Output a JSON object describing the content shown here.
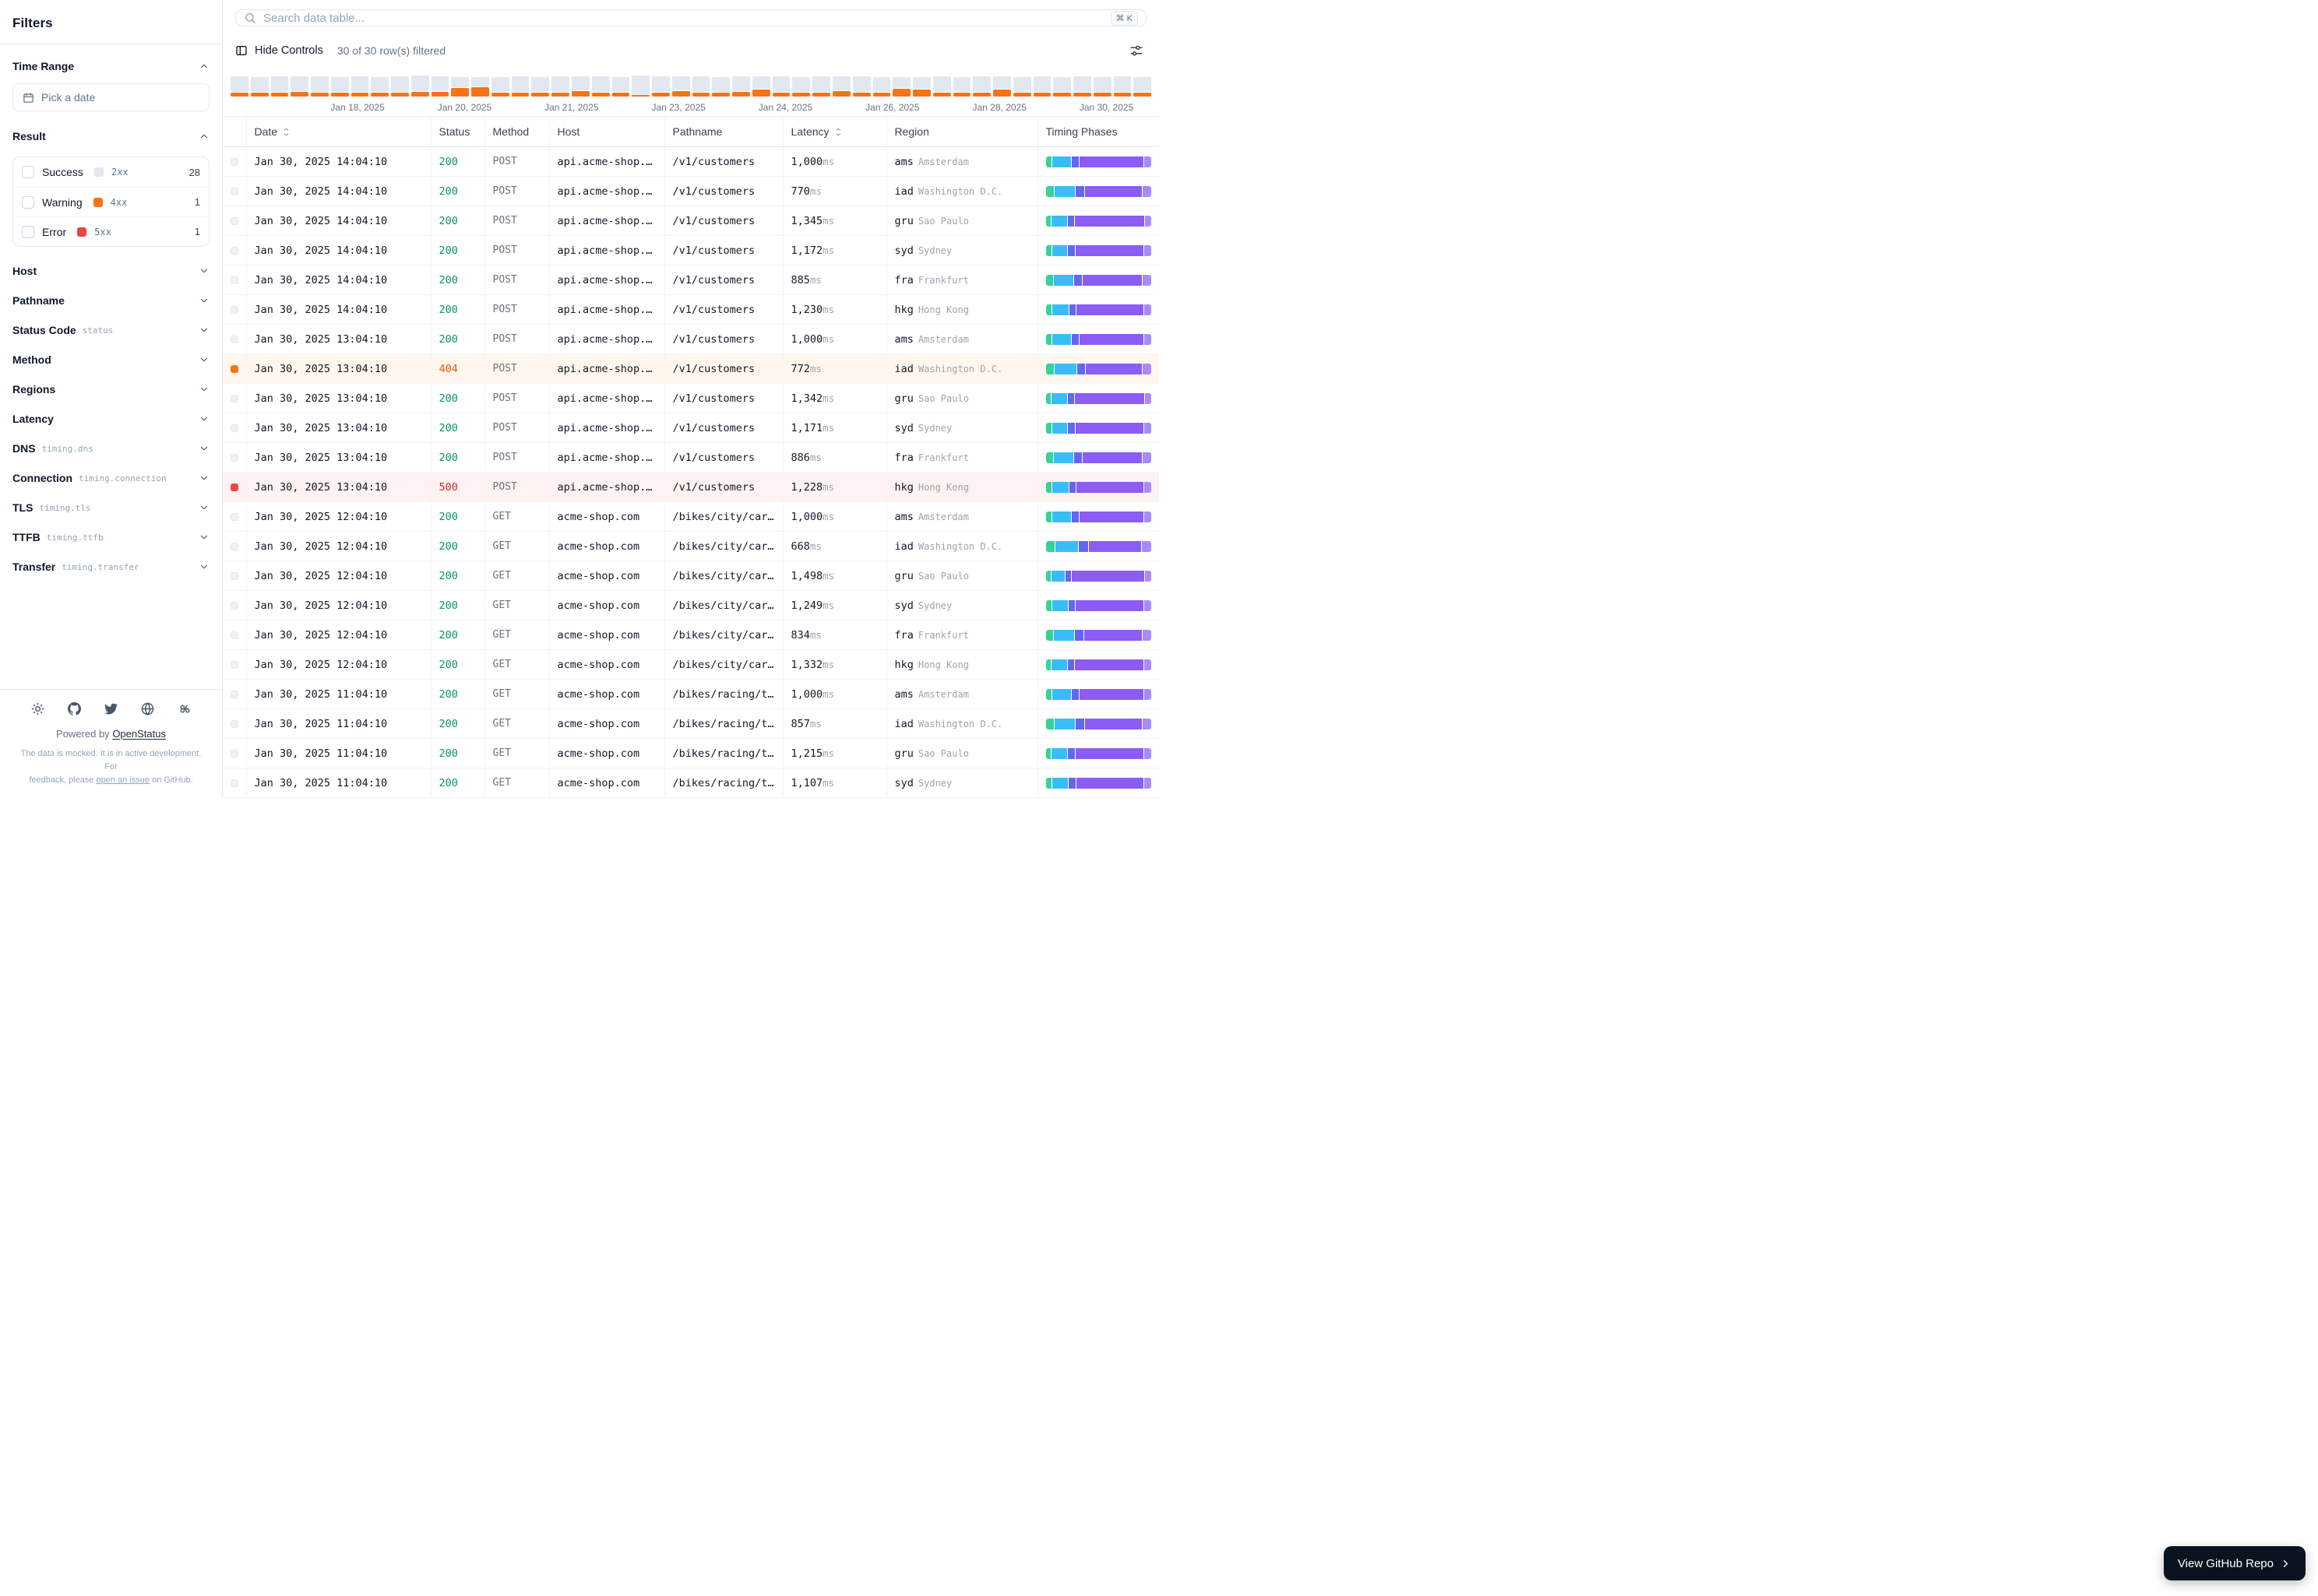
{
  "sidebar": {
    "title": "Filters",
    "time_range": {
      "label": "Time Range",
      "picker_placeholder": "Pick a date"
    },
    "result": {
      "label": "Result",
      "options": [
        {
          "label": "Success",
          "code": "2xx",
          "count": "28",
          "color": "#e2e8f0"
        },
        {
          "label": "Warning",
          "code": "4xx",
          "count": "1",
          "color": "#f97316"
        },
        {
          "label": "Error",
          "code": "5xx",
          "count": "1",
          "color": "#ef4444"
        }
      ]
    },
    "sections": [
      {
        "label": "Host",
        "tag": ""
      },
      {
        "label": "Pathname",
        "tag": ""
      },
      {
        "label": "Status Code",
        "tag": "status"
      },
      {
        "label": "Method",
        "tag": ""
      },
      {
        "label": "Regions",
        "tag": ""
      },
      {
        "label": "Latency",
        "tag": ""
      },
      {
        "label": "DNS",
        "tag": "timing.dns"
      },
      {
        "label": "Connection",
        "tag": "timing.connection"
      },
      {
        "label": "TLS",
        "tag": "timing.tls"
      },
      {
        "label": "TTFB",
        "tag": "timing.ttfb"
      },
      {
        "label": "Transfer",
        "tag": "timing.transfer"
      }
    ],
    "footer": {
      "powered_prefix": "Powered by",
      "brand_link": "OpenStatus",
      "note_line1": "The data is mocked. It is in active development. For",
      "note_line2_pre": "feedback, please ",
      "note_link": "open an issue",
      "note_line2_post": " on GitHub."
    }
  },
  "toolbar": {
    "search_placeholder": "Search data table...",
    "kbd": "⌘ K",
    "hide_controls_label": "Hide Controls",
    "filtered_text": "30 of 30 row(s) filtered"
  },
  "timeline": {
    "labels": [
      "Jan 18, 2025",
      "Jan 20, 2025",
      "Jan 21, 2025",
      "Jan 23, 2025",
      "Jan 24, 2025",
      "Jan 26, 2025",
      "Jan 28, 2025",
      "Jan 30, 2025"
    ],
    "bars": [
      [
        20,
        5
      ],
      [
        19,
        5
      ],
      [
        20,
        5
      ],
      [
        19,
        6
      ],
      [
        20,
        5
      ],
      [
        19,
        5
      ],
      [
        20,
        5
      ],
      [
        19,
        5
      ],
      [
        20,
        5
      ],
      [
        20,
        6
      ],
      [
        19,
        6
      ],
      [
        13,
        11
      ],
      [
        12,
        12
      ],
      [
        19,
        5
      ],
      [
        20,
        5
      ],
      [
        19,
        5
      ],
      [
        20,
        5
      ],
      [
        18,
        7
      ],
      [
        20,
        5
      ],
      [
        19,
        5
      ],
      [
        24,
        2
      ],
      [
        20,
        5
      ],
      [
        18,
        7
      ],
      [
        20,
        5
      ],
      [
        19,
        5
      ],
      [
        19,
        6
      ],
      [
        16,
        9
      ],
      [
        20,
        5
      ],
      [
        19,
        5
      ],
      [
        20,
        5
      ],
      [
        18,
        7
      ],
      [
        20,
        5
      ],
      [
        19,
        5
      ],
      [
        14,
        10
      ],
      [
        15,
        9
      ],
      [
        20,
        5
      ],
      [
        19,
        5
      ],
      [
        20,
        5
      ],
      [
        16,
        9
      ],
      [
        19,
        5
      ],
      [
        20,
        5
      ],
      [
        19,
        5
      ],
      [
        20,
        5
      ],
      [
        19,
        5
      ],
      [
        20,
        5
      ],
      [
        19,
        5
      ]
    ]
  },
  "table": {
    "columns": [
      {
        "label": "Date",
        "sortable": true
      },
      {
        "label": "Status",
        "sortable": false
      },
      {
        "label": "Method",
        "sortable": false
      },
      {
        "label": "Host",
        "sortable": false
      },
      {
        "label": "Pathname",
        "sortable": false
      },
      {
        "label": "Latency",
        "sortable": true
      },
      {
        "label": "Region",
        "sortable": false
      },
      {
        "label": "Timing Phases",
        "sortable": false
      }
    ],
    "latency_unit": "ms",
    "timing_colors": [
      "#34d399",
      "#38bdf8",
      "#6366f1",
      "#8b5cf6",
      "#a78bfa"
    ],
    "rows": [
      {
        "d": "Jan 30, 2025 14:04:10",
        "s": "200",
        "lvl": "success",
        "m": "POST",
        "h": "api.acme-shop.…",
        "p": "/v1/customers",
        "l": "1,000",
        "rc": "ams",
        "city": "Amsterdam",
        "t": [
          6,
          18,
          7,
          62,
          7
        ]
      },
      {
        "d": "Jan 30, 2025 14:04:10",
        "s": "200",
        "lvl": "success",
        "m": "POST",
        "h": "api.acme-shop.…",
        "p": "/v1/customers",
        "l": "770",
        "rc": "iad",
        "city": "Washington D.C.",
        "t": [
          8,
          20,
          8,
          56,
          8
        ]
      },
      {
        "d": "Jan 30, 2025 14:04:10",
        "s": "200",
        "lvl": "success",
        "m": "POST",
        "h": "api.acme-shop.…",
        "p": "/v1/customers",
        "l": "1,345",
        "rc": "gru",
        "city": "Sao Paulo",
        "t": [
          5,
          15,
          6,
          68,
          6
        ]
      },
      {
        "d": "Jan 30, 2025 14:04:10",
        "s": "200",
        "lvl": "success",
        "m": "POST",
        "h": "api.acme-shop.…",
        "p": "/v1/customers",
        "l": "1,172",
        "rc": "syd",
        "city": "Sydney",
        "t": [
          6,
          14,
          7,
          66,
          7
        ]
      },
      {
        "d": "Jan 30, 2025 14:04:10",
        "s": "200",
        "lvl": "success",
        "m": "POST",
        "h": "api.acme-shop.…",
        "p": "/v1/customers",
        "l": "885",
        "rc": "fra",
        "city": "Frankfurt",
        "t": [
          7,
          19,
          8,
          58,
          8
        ]
      },
      {
        "d": "Jan 30, 2025 14:04:10",
        "s": "200",
        "lvl": "success",
        "m": "POST",
        "h": "api.acme-shop.…",
        "p": "/v1/customers",
        "l": "1,230",
        "rc": "hkg",
        "city": "Hong Kong",
        "t": [
          6,
          16,
          6,
          65,
          7
        ]
      },
      {
        "d": "Jan 30, 2025 13:04:10",
        "s": "200",
        "lvl": "success",
        "m": "POST",
        "h": "api.acme-shop.…",
        "p": "/v1/customers",
        "l": "1,000",
        "rc": "ams",
        "city": "Amsterdam",
        "t": [
          6,
          18,
          7,
          62,
          7
        ]
      },
      {
        "d": "Jan 30, 2025 13:04:10",
        "s": "404",
        "lvl": "warning",
        "m": "POST",
        "h": "api.acme-shop.…",
        "p": "/v1/customers",
        "l": "772",
        "rc": "iad",
        "city": "Washington D.C.",
        "t": [
          8,
          21,
          8,
          55,
          8
        ]
      },
      {
        "d": "Jan 30, 2025 13:04:10",
        "s": "200",
        "lvl": "success",
        "m": "POST",
        "h": "api.acme-shop.…",
        "p": "/v1/customers",
        "l": "1,342",
        "rc": "gru",
        "city": "Sao Paulo",
        "t": [
          5,
          15,
          6,
          68,
          6
        ]
      },
      {
        "d": "Jan 30, 2025 13:04:10",
        "s": "200",
        "lvl": "success",
        "m": "POST",
        "h": "api.acme-shop.…",
        "p": "/v1/customers",
        "l": "1,171",
        "rc": "syd",
        "city": "Sydney",
        "t": [
          6,
          14,
          7,
          66,
          7
        ]
      },
      {
        "d": "Jan 30, 2025 13:04:10",
        "s": "200",
        "lvl": "success",
        "m": "POST",
        "h": "api.acme-shop.…",
        "p": "/v1/customers",
        "l": "886",
        "rc": "fra",
        "city": "Frankfurt",
        "t": [
          7,
          19,
          8,
          58,
          8
        ]
      },
      {
        "d": "Jan 30, 2025 13:04:10",
        "s": "500",
        "lvl": "error",
        "m": "POST",
        "h": "api.acme-shop.…",
        "p": "/v1/customers",
        "l": "1,228",
        "rc": "hkg",
        "city": "Hong Kong",
        "t": [
          6,
          16,
          6,
          65,
          7
        ]
      },
      {
        "d": "Jan 30, 2025 12:04:10",
        "s": "200",
        "lvl": "success",
        "m": "GET",
        "h": "acme-shop.com",
        "p": "/bikes/city/car…",
        "l": "1,000",
        "rc": "ams",
        "city": "Amsterdam",
        "t": [
          6,
          18,
          7,
          62,
          7
        ]
      },
      {
        "d": "Jan 30, 2025 12:04:10",
        "s": "200",
        "lvl": "success",
        "m": "GET",
        "h": "acme-shop.com",
        "p": "/bikes/city/car…",
        "l": "668",
        "rc": "iad",
        "city": "Washington D.C.",
        "t": [
          9,
          22,
          9,
          51,
          9
        ]
      },
      {
        "d": "Jan 30, 2025 12:04:10",
        "s": "200",
        "lvl": "success",
        "m": "GET",
        "h": "acme-shop.com",
        "p": "/bikes/city/car…",
        "l": "1,498",
        "rc": "gru",
        "city": "Sao Paulo",
        "t": [
          5,
          13,
          5,
          71,
          6
        ]
      },
      {
        "d": "Jan 30, 2025 12:04:10",
        "s": "200",
        "lvl": "success",
        "m": "GET",
        "h": "acme-shop.com",
        "p": "/bikes/city/car…",
        "l": "1,249",
        "rc": "syd",
        "city": "Sydney",
        "t": [
          6,
          15,
          6,
          66,
          7
        ]
      },
      {
        "d": "Jan 30, 2025 12:04:10",
        "s": "200",
        "lvl": "success",
        "m": "GET",
        "h": "acme-shop.com",
        "p": "/bikes/city/car…",
        "l": "834",
        "rc": "fra",
        "city": "Frankfurt",
        "t": [
          7,
          20,
          8,
          57,
          8
        ]
      },
      {
        "d": "Jan 30, 2025 12:04:10",
        "s": "200",
        "lvl": "success",
        "m": "GET",
        "h": "acme-shop.com",
        "p": "/bikes/city/car…",
        "l": "1,332",
        "rc": "hkg",
        "city": "Hong Kong",
        "t": [
          5,
          15,
          6,
          67,
          7
        ]
      },
      {
        "d": "Jan 30, 2025 11:04:10",
        "s": "200",
        "lvl": "success",
        "m": "GET",
        "h": "acme-shop.com",
        "p": "/bikes/racing/t…",
        "l": "1,000",
        "rc": "ams",
        "city": "Amsterdam",
        "t": [
          6,
          18,
          7,
          62,
          7
        ]
      },
      {
        "d": "Jan 30, 2025 11:04:10",
        "s": "200",
        "lvl": "success",
        "m": "GET",
        "h": "acme-shop.com",
        "p": "/bikes/racing/t…",
        "l": "857",
        "rc": "iad",
        "city": "Washington D.C.",
        "t": [
          8,
          20,
          8,
          56,
          8
        ]
      },
      {
        "d": "Jan 30, 2025 11:04:10",
        "s": "200",
        "lvl": "success",
        "m": "GET",
        "h": "acme-shop.com",
        "p": "/bikes/racing/t…",
        "l": "1,215",
        "rc": "gru",
        "city": "Sao Paulo",
        "t": [
          5,
          15,
          7,
          66,
          7
        ]
      },
      {
        "d": "Jan 30, 2025 11:04:10",
        "s": "200",
        "lvl": "success",
        "m": "GET",
        "h": "acme-shop.com",
        "p": "/bikes/racing/t…",
        "l": "1,107",
        "rc": "syd",
        "city": "Sydney",
        "t": [
          6,
          15,
          7,
          65,
          7
        ]
      }
    ]
  },
  "github_button": {
    "label": "View GitHub Repo"
  }
}
